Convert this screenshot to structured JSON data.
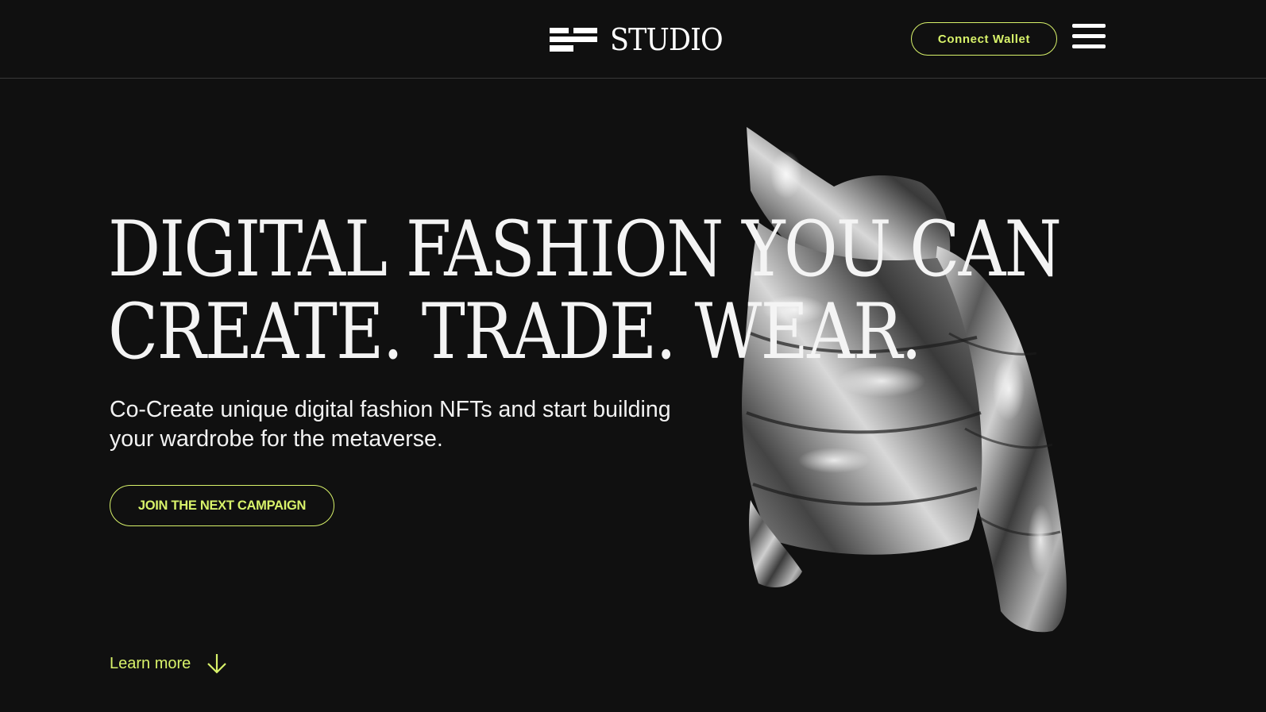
{
  "header": {
    "brand_name": "STUDIO",
    "logo_icon": "stripes-logo-icon",
    "connect_label": "Connect Wallet",
    "menu_icon": "hamburger-menu-icon"
  },
  "hero": {
    "headline_line1": "DIGITAL FASHION YOU CAN",
    "headline_line2": "CREATE. TRADE. WEAR.",
    "subhead_line1": "Co-Create unique digital fashion NFTs and start building",
    "subhead_line2": "your wardrobe for the metaverse.",
    "cta_label": "JOIN THE NEXT CAMPAIGN",
    "image": "silver-puffer-jacket-image"
  },
  "footer_link": {
    "label": "Learn more",
    "icon": "arrow-down-icon"
  },
  "colors": {
    "background": "#101010",
    "accent": "#d8f26a",
    "text": "#ffffff",
    "divider": "#3a3a3a"
  }
}
